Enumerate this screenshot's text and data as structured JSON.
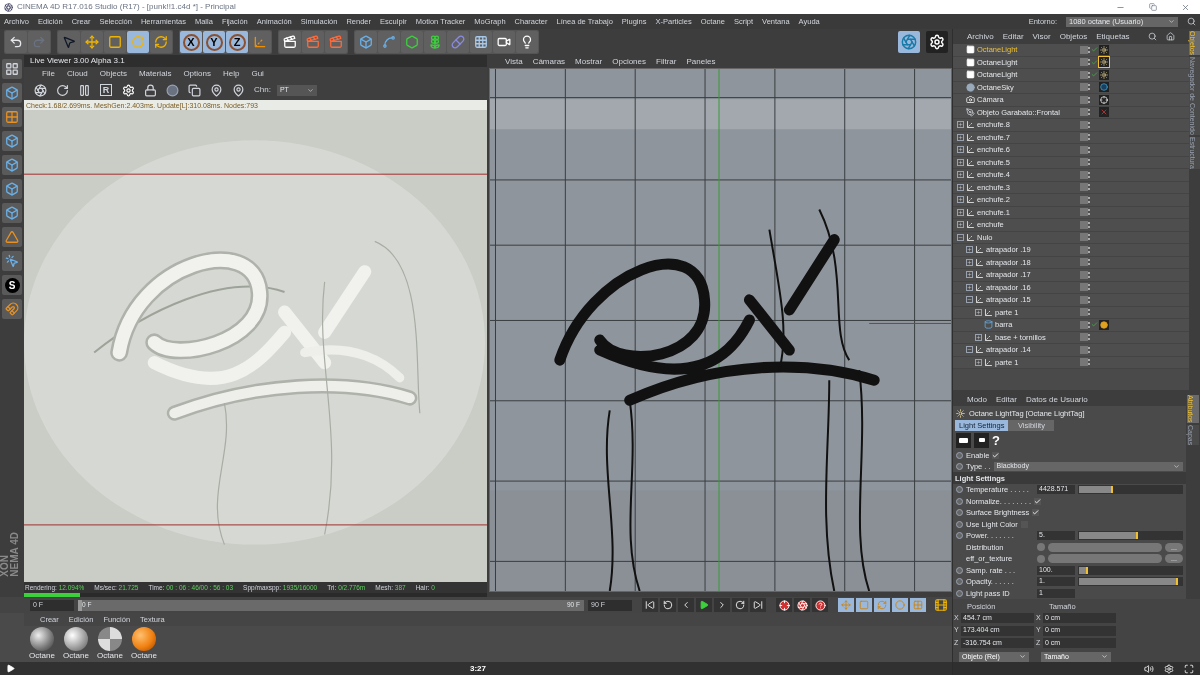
{
  "title_bar": {
    "title": "CINEMA 4D R17.016 Studio (R17) - [punk!!1.c4d *] - Principal"
  },
  "menu_bar": {
    "items": [
      "Archivo",
      "Edición",
      "Crear",
      "Selección",
      "Herramientas",
      "Malla",
      "Fijación",
      "Animación",
      "Simulación",
      "Render",
      "Esculpir",
      "Motion Tracker",
      "MoGraph",
      "Character",
      "Línea de Trabajo",
      "Plugins",
      "X-Particles",
      "Octane",
      "Script",
      "Ventana",
      "Ayuda"
    ],
    "layout_label": "Entorno:",
    "layout_value": "1080 octane (Usuario)"
  },
  "toolbar": {
    "groups": [
      [
        {
          "kind": "undo",
          "selected": false
        },
        {
          "kind": "redo",
          "selected": false
        }
      ],
      [
        {
          "kind": "select",
          "selected": false
        },
        {
          "kind": "move",
          "selected": false
        },
        {
          "kind": "scale",
          "selected": false
        },
        {
          "kind": "rotate",
          "selected": true
        },
        {
          "kind": "recent",
          "selected": false
        }
      ],
      [
        {
          "kind": "axis",
          "label": "X",
          "selected": true
        },
        {
          "kind": "axis",
          "label": "Y",
          "selected": true
        },
        {
          "kind": "axis",
          "label": "Z",
          "selected": true
        },
        {
          "kind": "coords",
          "selected": false
        }
      ],
      [
        {
          "kind": "render-view",
          "selected": false
        },
        {
          "kind": "render",
          "selected": false
        },
        {
          "kind": "render-settings",
          "selected": false
        }
      ],
      [
        {
          "kind": "cube",
          "selected": false
        },
        {
          "kind": "spline",
          "selected": false
        },
        {
          "kind": "nurbs",
          "selected": false
        },
        {
          "kind": "array",
          "selected": false
        },
        {
          "kind": "deformer",
          "selected": false
        },
        {
          "kind": "floor",
          "selected": false
        },
        {
          "kind": "camera",
          "selected": false
        },
        {
          "kind": "light",
          "selected": false
        }
      ]
    ],
    "right_tools": [
      {
        "kind": "octane",
        "selected": true
      },
      {
        "kind": "settings",
        "selected": false
      }
    ]
  },
  "left_strip": [
    {
      "kind": "layout"
    },
    {
      "kind": "cube"
    },
    {
      "kind": "checker"
    },
    {
      "kind": "cube"
    },
    {
      "kind": "cube"
    },
    {
      "kind": "cube"
    },
    {
      "kind": "cube"
    },
    {
      "kind": "angle"
    },
    {
      "kind": "mouse"
    },
    {
      "kind": "letter",
      "label": "S"
    },
    {
      "kind": "magnet"
    }
  ],
  "brand": [
    "XON",
    "NEMA 4D"
  ],
  "live_viewer": {
    "title": "Live Viewer 3.00 Alpha 3.1",
    "menu": [
      "File",
      "Cloud",
      "Objects",
      "Materials",
      "Options",
      "Help",
      "Gui"
    ],
    "tools": [
      {
        "kind": "aperture"
      },
      {
        "kind": "refresh"
      },
      {
        "kind": "pause"
      },
      {
        "kind": "letter",
        "label": "R"
      },
      {
        "kind": "settings"
      },
      {
        "kind": "lock"
      },
      {
        "kind": "sphere"
      },
      {
        "kind": "region"
      },
      {
        "kind": "pin"
      },
      {
        "kind": "pin"
      }
    ],
    "channel_label": "Chn:",
    "channel_value": "PT",
    "stats": "Check:1.68/2.699ms. MeshGen:2.403ms. Update[L]:310.08ms. Nodes:793",
    "status": [
      {
        "label": "Rendering:",
        "value": "12.094%"
      },
      {
        "label": "Ms/sec:",
        "value": "21.725"
      },
      {
        "label": "Time:",
        "value": "00 : 06 : 46/00 : 56 : 03"
      },
      {
        "label": "Spp/maxspp:",
        "value": "1935/16000"
      },
      {
        "label": "Tri:",
        "value": "0/2.776m"
      },
      {
        "label": "Mesh:",
        "value": "387"
      },
      {
        "label": "Hair:",
        "value": "0"
      }
    ],
    "progress": {
      "level": 0.12
    }
  },
  "viewport": {
    "menu": [
      "Vista",
      "Cámaras",
      "Mostrar",
      "Opciones",
      "Filtrar",
      "Paneles"
    ]
  },
  "timeline": {
    "start": "0 F",
    "track_start": "0 F",
    "track_end": "90 F",
    "end": "90 F",
    "level": 0,
    "transport": [
      {
        "kind": "first"
      },
      {
        "kind": "loop-back"
      },
      {
        "kind": "prev"
      },
      {
        "kind": "play"
      },
      {
        "kind": "next"
      },
      {
        "kind": "loop"
      },
      {
        "kind": "last"
      }
    ],
    "record": [
      {
        "kind": "record"
      },
      {
        "kind": "keys"
      },
      {
        "kind": "help"
      }
    ],
    "key_tools": [
      {
        "kind": "move"
      },
      {
        "kind": "scale"
      },
      {
        "kind": "rotate"
      },
      {
        "kind": "param"
      },
      {
        "kind": "grid"
      }
    ]
  },
  "materials": {
    "menu": [
      "Crear",
      "Edición",
      "Función",
      "Textura"
    ],
    "items": [
      {
        "kind": "glass",
        "label": "Octane"
      },
      {
        "kind": "metal",
        "label": "Octane"
      },
      {
        "kind": "checker",
        "label": "Octane"
      },
      {
        "kind": "orange",
        "label": "Octane"
      }
    ]
  },
  "object_manager": {
    "menu": [
      "Archivo",
      "Editar",
      "Visor",
      "Objetos",
      "Etiquetas"
    ],
    "side_tabs": [
      {
        "label": "Objetos",
        "selected": true
      },
      {
        "label": "Navegador de Contenido",
        "selected": false
      },
      {
        "label": "Estructura",
        "selected": false
      }
    ],
    "objects": [
      {
        "name": "OctaneLight",
        "kind": "light",
        "selected": true,
        "enabled": true,
        "tag": {
          "kind": "light",
          "selected": false
        }
      },
      {
        "name": "OctaneLight",
        "kind": "light",
        "selected": false,
        "enabled": true,
        "tag": {
          "kind": "light",
          "selected": true
        }
      },
      {
        "name": "OctaneLight",
        "kind": "light",
        "selected": false,
        "enabled": true,
        "tag": {
          "kind": "light",
          "selected": false
        }
      },
      {
        "name": "OctaneSky",
        "kind": "sky",
        "selected": false,
        "enabled": false,
        "tag": {
          "kind": "sky",
          "selected": false
        }
      },
      {
        "name": "Cámara",
        "kind": "camera",
        "selected": false,
        "enabled": false,
        "tag": {
          "kind": "target",
          "selected": false
        }
      },
      {
        "name": "Objeto Garabato::Frontal",
        "kind": "sketch",
        "selected": false,
        "enabled": false,
        "tag": {
          "kind": "error",
          "selected": false
        }
      },
      {
        "name": "enchufe.8",
        "kind": "null",
        "selected": false,
        "enabled": false,
        "expanded": false
      },
      {
        "name": "enchufe.7",
        "kind": "null",
        "selected": false,
        "enabled": false,
        "expanded": false
      },
      {
        "name": "enchufe.6",
        "kind": "null",
        "selected": false,
        "enabled": false,
        "expanded": false
      },
      {
        "name": "enchufe.5",
        "kind": "null",
        "selected": false,
        "enabled": false,
        "expanded": false
      },
      {
        "name": "enchufe.4",
        "kind": "null",
        "selected": false,
        "enabled": false,
        "expanded": false
      },
      {
        "name": "enchufe.3",
        "kind": "null",
        "selected": false,
        "enabled": false,
        "expanded": false
      },
      {
        "name": "enchufe.2",
        "kind": "null",
        "selected": false,
        "enabled": false,
        "expanded": false
      },
      {
        "name": "enchufe.1",
        "kind": "null",
        "selected": false,
        "enabled": false,
        "expanded": false
      },
      {
        "name": "enchufe",
        "kind": "null",
        "selected": false,
        "enabled": false,
        "expanded": false
      },
      {
        "name": "Nulo",
        "kind": "null",
        "selected": false,
        "enabled": false,
        "expanded": true,
        "children": [
          {
            "name": "atrapador .19",
            "kind": "null",
            "selected": false,
            "enabled": false,
            "expanded": false
          },
          {
            "name": "atrapador .18",
            "kind": "null",
            "selected": false,
            "enabled": false,
            "expanded": false
          },
          {
            "name": "atrapador .17",
            "kind": "null",
            "selected": false,
            "enabled": false,
            "expanded": false
          },
          {
            "name": "atrapador .16",
            "kind": "null",
            "selected": false,
            "enabled": false,
            "expanded": false
          },
          {
            "name": "atrapador .15",
            "kind": "null",
            "selected": false,
            "enabled": false,
            "expanded": true,
            "children": [
              {
                "name": "parte 1",
                "kind": "null",
                "selected": false,
                "enabled": false,
                "expanded": false
              },
              {
                "name": "barra",
                "kind": "cylinder",
                "selected": false,
                "enabled": true,
                "tag": {
                  "kind": "material",
                  "selected": false
                }
              },
              {
                "name": "base + tornillos",
                "kind": "null",
                "selected": false,
                "enabled": false,
                "expanded": false
              }
            ]
          },
          {
            "name": "atrapador .14",
            "kind": "null",
            "selected": false,
            "enabled": false,
            "expanded": true,
            "children": [
              {
                "name": "parte 1",
                "kind": "null",
                "selected": false,
                "enabled": false,
                "expanded": false
              }
            ]
          }
        ]
      }
    ]
  },
  "attributes": {
    "menu": [
      "Modo",
      "Editar",
      "Datos de Usuario"
    ],
    "side_tabs": [
      {
        "label": "Atributos",
        "selected": true
      },
      {
        "label": "Capas",
        "selected": false
      }
    ],
    "object_title": "Octane LightTag [Octane LightTag]",
    "tabs": [
      {
        "label": "Light Settings",
        "selected": true
      },
      {
        "label": "Visibility",
        "selected": false
      }
    ],
    "help": "?",
    "params": [
      {
        "kind": "checkbox",
        "label": "Enable",
        "checked": true
      },
      {
        "kind": "dropdown",
        "label": "Type . .",
        "value": "Blackbody"
      },
      {
        "kind": "header",
        "label": "Light Settings"
      },
      {
        "kind": "slider",
        "label": "Temperature . . . . .",
        "value": "4428.571",
        "level": 0.34
      },
      {
        "kind": "checkbox",
        "label": "Normalize. . . . . . . .",
        "checked": true
      },
      {
        "kind": "checkbox",
        "label": "Surface Brightness",
        "checked": true
      },
      {
        "kind": "checkbox",
        "label": "Use Light Color",
        "checked": false
      },
      {
        "kind": "slider",
        "label": "Power. . . . . . .",
        "value": "5.",
        "level": 0.6
      },
      {
        "kind": "texture",
        "label": "Distribution",
        "button": "..."
      },
      {
        "kind": "texture",
        "label": "eff_or_texture",
        "button": "..."
      },
      {
        "kind": "slider",
        "label": "Samp. rate . . .",
        "value": "100.",
        "level": 0.09
      },
      {
        "kind": "slider",
        "label": "Opacity. . . . . .",
        "value": "1.",
        "level": 1
      },
      {
        "kind": "number",
        "label": "Light pass ID",
        "value": "1"
      }
    ]
  },
  "coordinates": {
    "columns": [
      {
        "heading": "Posición",
        "fields": [
          {
            "axis": "X",
            "value": "454.7 cm"
          },
          {
            "axis": "Y",
            "value": "173.404 cm"
          },
          {
            "axis": "Z",
            "value": "-316.754 cm"
          }
        ],
        "mode": "Objeto (Rel)"
      },
      {
        "heading": "Tamaño",
        "fields": [
          {
            "axis": "X",
            "value": "0 cm"
          },
          {
            "axis": "Y",
            "value": "0 cm"
          },
          {
            "axis": "Z",
            "value": "0 cm"
          }
        ],
        "mode": "Tamaño"
      }
    ]
  },
  "video_player": {
    "time": "3:27"
  }
}
